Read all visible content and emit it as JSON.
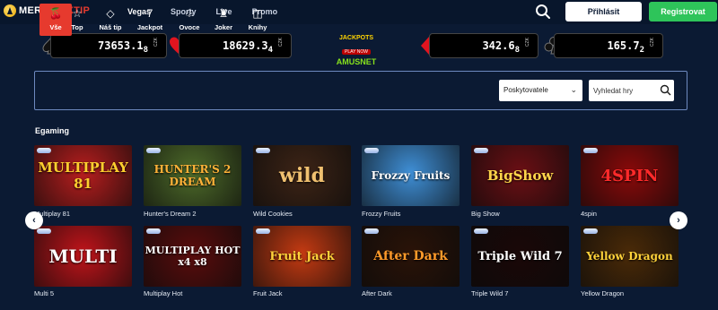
{
  "brand": {
    "name_main": "MERKUR",
    "name_accent": "XTIP"
  },
  "nav": [
    "Vegas",
    "Sporty",
    "Live",
    "Promo"
  ],
  "header": {
    "login": "Přihlásit",
    "register": "Registrovat"
  },
  "jackpots": [
    {
      "suit": "spade",
      "value": "73653.1",
      "sub": "8",
      "currency": "CZK"
    },
    {
      "suit": "heart",
      "value": "18629.3",
      "sub": "4",
      "currency": "CZK"
    },
    {
      "suit": "diamond",
      "value": "342.6",
      "sub": "8",
      "currency": "CZK"
    },
    {
      "suit": "club",
      "value": "165.7",
      "sub": "2",
      "currency": "CZK"
    }
  ],
  "jackpot_brand": {
    "line1": "JACKPOTS",
    "line2": "PLAY NOW",
    "line3": "AMUSNET"
  },
  "categories": [
    {
      "label": "Vše",
      "icon": "cherries-icon"
    },
    {
      "label": "Top",
      "icon": "star-icon"
    },
    {
      "label": "Náš tip",
      "icon": "diamond-icon"
    },
    {
      "label": "Jackpot",
      "icon": "seven-icon"
    },
    {
      "label": "Ovoce",
      "icon": "cherry-icon"
    },
    {
      "label": "Joker",
      "icon": "jester-hat-icon"
    },
    {
      "label": "Knihy",
      "icon": "book-icon"
    }
  ],
  "filters": {
    "provider_label": "Poskytovatele",
    "search_placeholder": "Vyhledat hry"
  },
  "section": {
    "title": "Egaming"
  },
  "games": [
    {
      "name": "Multiplay 81",
      "art": "MULTIPLAY 81",
      "bg": "#b81e1e",
      "fg": "#ffcf2e"
    },
    {
      "name": "Hunter's Dream 2",
      "art": "HUNTER'S 2 DREAM",
      "bg": "#4e6b2a",
      "fg": "#ffb238"
    },
    {
      "name": "Wild Cookies",
      "art": "wild",
      "bg": "#3d2416",
      "fg": "#f0c070"
    },
    {
      "name": "Frozzy Fruits",
      "art": "Frozzy Fruits",
      "bg": "#3f8fd6",
      "fg": "#ffffff"
    },
    {
      "name": "Big Show",
      "art": "BigShow",
      "bg": "#6b0f14",
      "fg": "#ffd54a"
    },
    {
      "name": "4spin",
      "art": "4SPIN",
      "bg": "#8a0a0a",
      "fg": "#ff2a2a"
    },
    {
      "name": "Multi 5",
      "art": "MULTI",
      "bg": "#c0141a",
      "fg": "#ffffff"
    },
    {
      "name": "Multiplay Hot",
      "art": "MULTIPLAY HOT x4 x8",
      "bg": "#5a0d0d",
      "fg": "#ffffff"
    },
    {
      "name": "Fruit Jack",
      "art": "Fruit Jack",
      "bg": "#c43a12",
      "fg": "#ffd23a"
    },
    {
      "name": "After Dark",
      "art": "After Dark",
      "bg": "#2a1308",
      "fg": "#ff9a2a"
    },
    {
      "name": "Triple Wild 7",
      "art": "Triple Wild 7",
      "bg": "#1a0808",
      "fg": "#ffffff"
    },
    {
      "name": "Yellow Dragon",
      "art": "Yellow Dragon",
      "bg": "#4a2a08",
      "fg": "#ffd23a"
    }
  ],
  "colors": {
    "accent": "#e63a2e",
    "register": "#2ec45a",
    "background": "#0b1a33"
  }
}
